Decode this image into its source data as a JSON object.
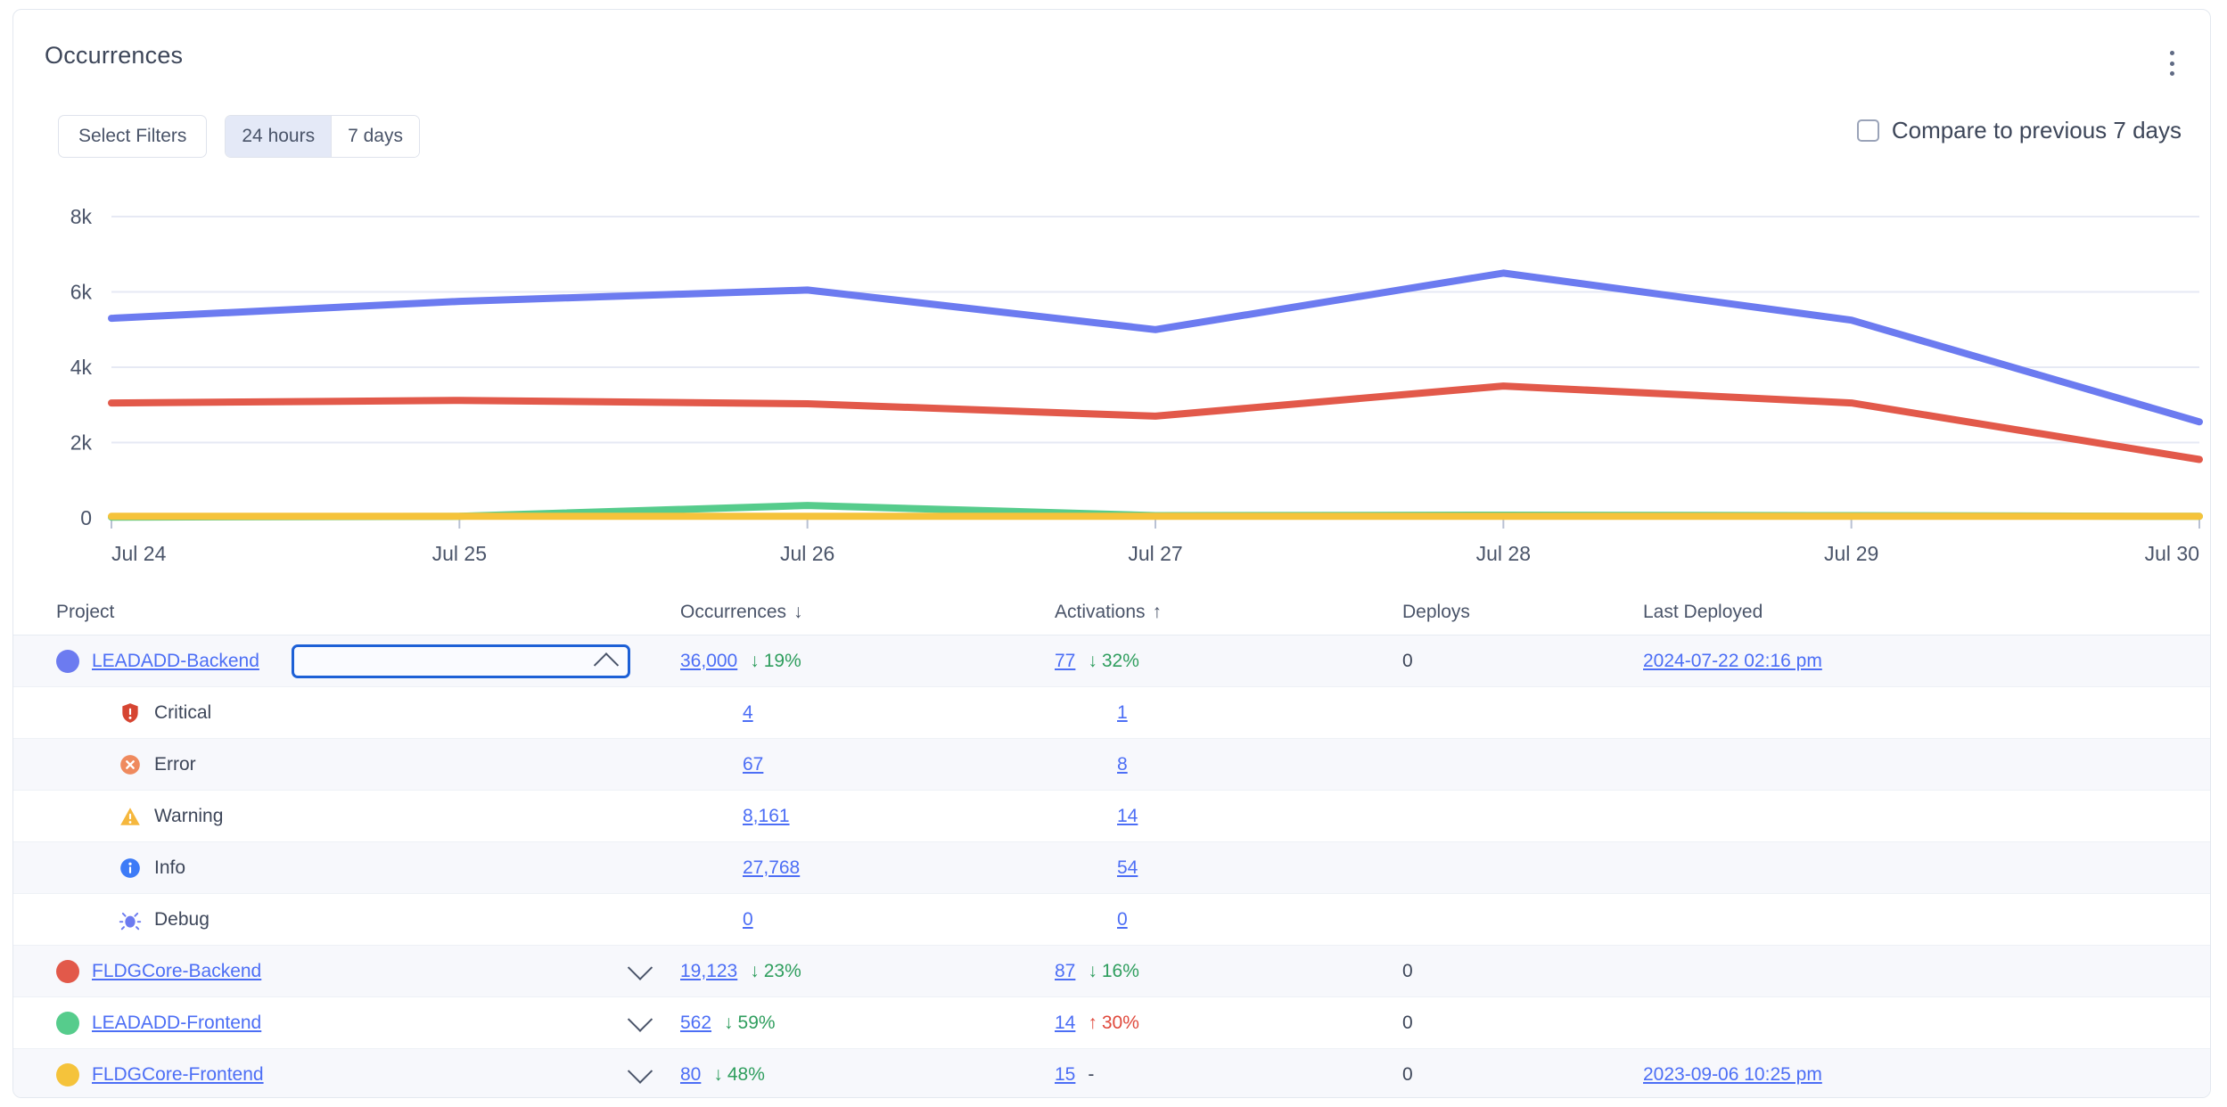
{
  "card": {
    "title": "Occurrences",
    "menu_icon": "kebab-menu-icon"
  },
  "toolbar": {
    "select_filters_label": "Select Filters",
    "ranges": [
      {
        "label": "24 hours",
        "active": true
      },
      {
        "label": "7 days",
        "active": false
      }
    ],
    "compare_label": "Compare to previous 7 days",
    "compare_checked": false
  },
  "chart_data": {
    "type": "line",
    "title": "Occurrences",
    "xlabel": "",
    "ylabel": "",
    "x": [
      "Jul 24",
      "Jul 25",
      "Jul 26",
      "Jul 27",
      "Jul 28",
      "Jul 29",
      "Jul 30"
    ],
    "ytick_labels": [
      "0",
      "2k",
      "4k",
      "6k",
      "8k"
    ],
    "ylim": [
      0,
      8000
    ],
    "grid": true,
    "legend": "none",
    "series": [
      {
        "name": "LEADADD-Backend",
        "color": "#6c7bf0",
        "values": [
          5300,
          5750,
          6050,
          5000,
          6500,
          5250,
          2550
        ]
      },
      {
        "name": "FLDGCore-Backend",
        "color": "#e2594a",
        "values": [
          3050,
          3120,
          3030,
          2700,
          3500,
          3050,
          1550
        ]
      },
      {
        "name": "LEADADD-Frontend",
        "color": "#56cc8c",
        "values": [
          20,
          40,
          330,
          60,
          70,
          60,
          40
        ]
      },
      {
        "name": "FLDGCore-Frontend",
        "color": "#f5c33b",
        "values": [
          40,
          40,
          40,
          40,
          40,
          40,
          40
        ]
      }
    ]
  },
  "table": {
    "columns": [
      {
        "label": "Project",
        "sort": ""
      },
      {
        "label": "Occurrences",
        "sort": "↓"
      },
      {
        "label": "Activations",
        "sort": "↑"
      },
      {
        "label": "Deploys",
        "sort": ""
      },
      {
        "label": "Last Deployed",
        "sort": ""
      }
    ],
    "rows": [
      {
        "kind": "project",
        "name": "LEADADD-Backend",
        "color": "#6c7bf0",
        "expanded": true,
        "occurrences": "36,000",
        "occ_delta": "19%",
        "occ_dir": "down",
        "activations": "77",
        "act_delta": "32%",
        "act_dir": "down",
        "deploys": "0",
        "last_deployed": "2024-07-22 02:16 pm"
      },
      {
        "kind": "severity",
        "icon": "critical-shield-icon",
        "label": "Critical",
        "occurrences": "4",
        "activations": "1",
        "deploys": "",
        "last_deployed": ""
      },
      {
        "kind": "severity",
        "icon": "error-circle-icon",
        "label": "Error",
        "occurrences": "67",
        "activations": "8",
        "deploys": "",
        "last_deployed": ""
      },
      {
        "kind": "severity",
        "icon": "warning-triangle-icon",
        "label": "Warning",
        "occurrences": "8,161",
        "activations": "14",
        "deploys": "",
        "last_deployed": ""
      },
      {
        "kind": "severity",
        "icon": "info-circle-icon",
        "label": "Info",
        "occurrences": "27,768",
        "activations": "54",
        "deploys": "",
        "last_deployed": ""
      },
      {
        "kind": "severity",
        "icon": "debug-bug-icon",
        "label": "Debug",
        "occurrences": "0",
        "activations": "0",
        "deploys": "",
        "last_deployed": ""
      },
      {
        "kind": "project",
        "name": "FLDGCore-Backend",
        "color": "#e2594a",
        "expanded": false,
        "occurrences": "19,123",
        "occ_delta": "23%",
        "occ_dir": "down",
        "activations": "87",
        "act_delta": "16%",
        "act_dir": "down",
        "deploys": "0",
        "last_deployed": ""
      },
      {
        "kind": "project",
        "name": "LEADADD-Frontend",
        "color": "#56cc8c",
        "expanded": false,
        "occurrences": "562",
        "occ_delta": "59%",
        "occ_dir": "down",
        "activations": "14",
        "act_delta": "30%",
        "act_dir": "up",
        "deploys": "0",
        "last_deployed": ""
      },
      {
        "kind": "project",
        "name": "FLDGCore-Frontend",
        "color": "#f5c33b",
        "expanded": false,
        "occurrences": "80",
        "occ_delta": "48%",
        "occ_dir": "down",
        "activations": "15",
        "act_delta": "-",
        "act_dir": "none",
        "deploys": "0",
        "last_deployed": "2023-09-06 10:25 pm"
      }
    ]
  }
}
